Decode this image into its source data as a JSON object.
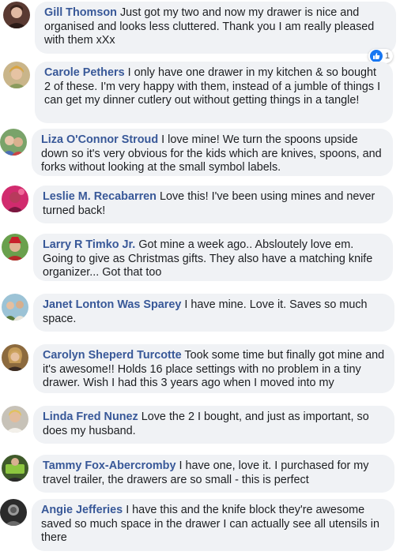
{
  "comments": [
    {
      "author": "Gill Thomson",
      "text": "Just got my two and now my drawer is nice and organised and looks less cluttered. Thank you I am really pleased with them xXx",
      "reaction_count": "1"
    },
    {
      "author": "Carole Pethers",
      "text": "I only have one drawer in my kitchen & so bought 2 of these. I'm very happy with them, instead of a jumble of things I can get my dinner cutlery out without getting things in a tangle!"
    },
    {
      "author": "Liza O'Connor Stroud",
      "text": "I love mine! We turn the spoons upside down so it's very obvious for the kids which are knives, spoons, and forks without looking at the small symbol labels."
    },
    {
      "author": "Leslie M. Recabarren",
      "text": "Love this! I've been using mines and never turned back!"
    },
    {
      "author": "Larry R Timko Jr.",
      "text": "Got mine a week ago.. Absloutely love em. Going to give as Christmas gifts. They also have a matching knife organizer... Got that too"
    },
    {
      "author": "Janet Lonton Was Sparey",
      "text": "I have mine. Love it. Saves so much space."
    },
    {
      "author": "Carolyn Sheperd Turcotte",
      "text": "Took some time but finally got mine and it's awesome!! Holds 16 place settings with no problem in a tiny drawer. Wish I had this 3 years ago when I moved into my"
    },
    {
      "author": "Linda Fred Nunez",
      "text": "Love the 2 I bought, and just as important, so does my husband."
    },
    {
      "author": "Tammy Fox-Abercromby",
      "text": "I have one, love it. I purchased for my travel trailer, the drawers are so small - this is perfect"
    },
    {
      "author": "Angie Jefferies",
      "text": "I have this and the knife block they're awesome saved so much space in the drawer I can actually see all utensils in there"
    }
  ],
  "colors": {
    "author": "#385898",
    "bubble": "#f0f2f5",
    "text": "#1c1e21",
    "like": "#1877f2"
  }
}
